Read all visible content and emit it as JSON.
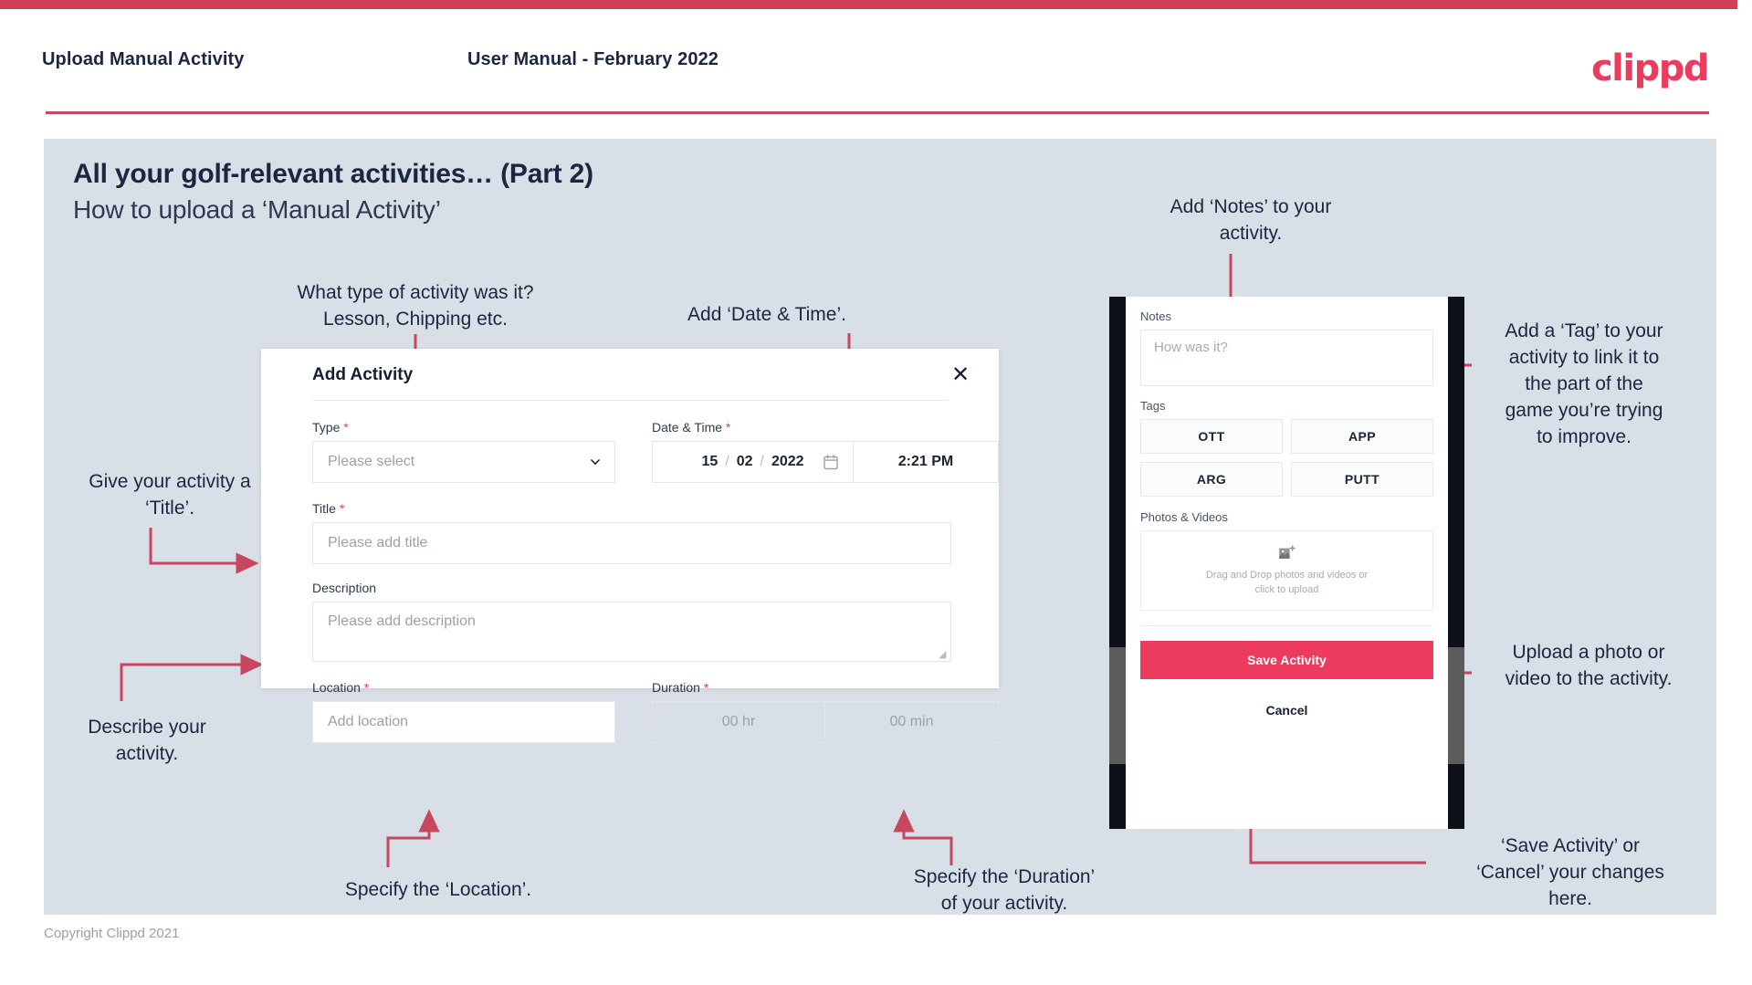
{
  "header": {
    "title": "Upload Manual Activity",
    "subtitle": "User Manual - February 2022",
    "logo": "clippd"
  },
  "slide": {
    "title": "All your golf-relevant activities… (Part 2)",
    "subtitle": "How to upload a ‘Manual Activity’"
  },
  "annotations": {
    "type_hint": "What type of activity was it?\nLesson, Chipping etc.",
    "datetime_hint": "Add ‘Date & Time’.",
    "title_hint": "Give your activity a\n‘Title’.",
    "description_hint": "Describe your\nactivity.",
    "location_hint": "Specify the ‘Location’.",
    "duration_hint": "Specify the ‘Duration’\nof your activity.",
    "notes_hint": "Add ‘Notes’ to your\nactivity.",
    "tags_hint": "Add a ‘Tag’ to your\nactivity to link it to\nthe part of the\ngame you’re trying\nto improve.",
    "upload_hint": "Upload a photo or\nvideo to the activity.",
    "save_cancel_hint": "‘Save Activity’ or\n‘Cancel’ your changes\nhere."
  },
  "dialog": {
    "title": "Add Activity",
    "close_icon": "close-icon",
    "fields": {
      "type": {
        "label": "Type",
        "required": "*",
        "placeholder": "Please select",
        "chevron_icon": "chevron-down-icon"
      },
      "datetime": {
        "label": "Date & Time",
        "required": "*",
        "day": "15",
        "month": "02",
        "year": "2022",
        "separator": "/",
        "time": "2:21 PM",
        "calendar_icon": "calendar-icon"
      },
      "title": {
        "label": "Title",
        "required": "*",
        "placeholder": "Please add title"
      },
      "description": {
        "label": "Description",
        "required": "",
        "placeholder": "Please add description"
      },
      "location": {
        "label": "Location",
        "required": "*",
        "placeholder": "Add location"
      },
      "duration": {
        "label": "Duration",
        "required": "*",
        "hours_placeholder": "00 hr",
        "minutes_placeholder": "00 min"
      }
    }
  },
  "phone": {
    "notes": {
      "label": "Notes",
      "placeholder": "How was it?"
    },
    "tags": {
      "label": "Tags",
      "items": [
        "OTT",
        "APP",
        "ARG",
        "PUTT"
      ]
    },
    "photos": {
      "label": "Photos & Videos",
      "icon": "add-image-icon",
      "line1": "Drag and Drop photos and videos or",
      "line2": "click to upload"
    },
    "save_label": "Save Activity",
    "cancel_label": "Cancel"
  },
  "footer": {
    "copyright": "Copyright Clippd 2021"
  },
  "colors": {
    "brand_pink": "#ec3b5c",
    "header_rule": "#c9465f",
    "panel_bg": "#d8dfe6",
    "text_dark": "#1b2640",
    "arrow": "#c9465f"
  }
}
